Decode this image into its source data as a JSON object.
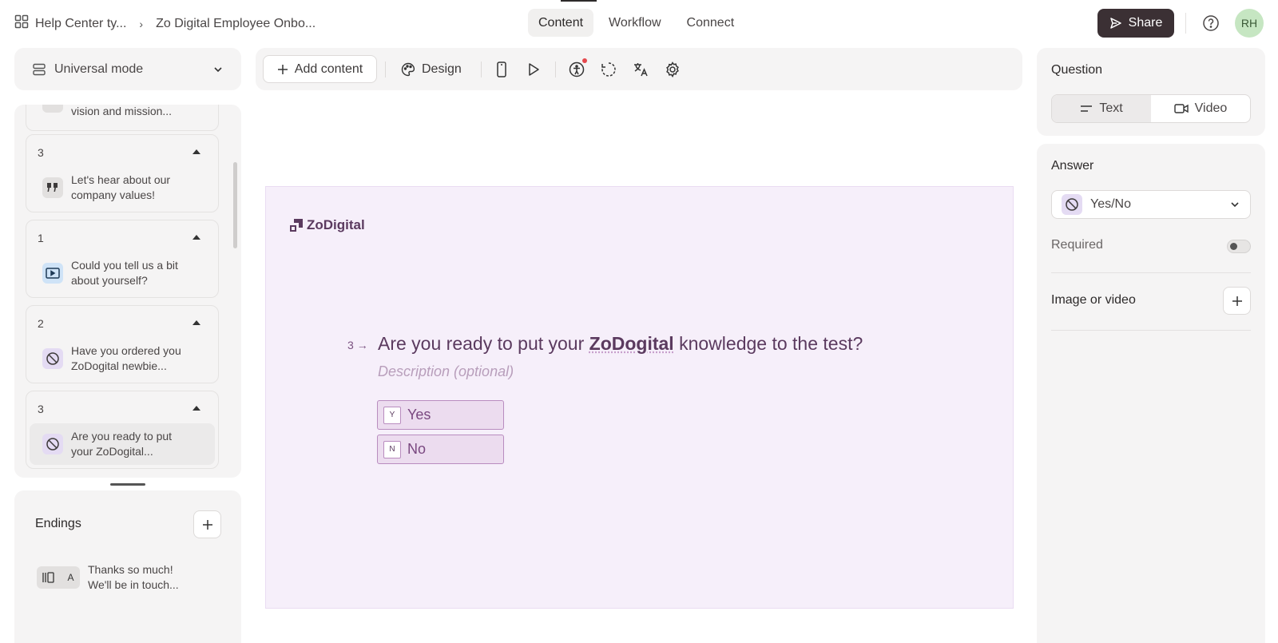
{
  "header": {
    "breadcrumb_workspace": "Help Center ty...",
    "breadcrumb_form": "Zo Digital Employee Onbo...",
    "tabs": [
      "Content",
      "Workflow",
      "Connect"
    ],
    "active_tab": "Content",
    "share_label": "Share",
    "avatar_initials": "RH"
  },
  "sidebar": {
    "mode_label": "Universal mode",
    "partial_item_text": "vision and mission...",
    "questions": [
      {
        "number": "3",
        "text_line1": "Let's hear about our",
        "text_line2": "company values!",
        "icon": "quote-icon"
      },
      {
        "number": "1",
        "text_line1": "Could you tell us a bit",
        "text_line2": "about yourself?",
        "icon": "video-icon"
      },
      {
        "number": "2",
        "text_line1": "Have you ordered you",
        "text_line2": "ZoDogital newbie...",
        "icon": "yes-no-icon"
      },
      {
        "number": "3",
        "text_line1": "Are you ready to put",
        "text_line2": "your ZoDogital...",
        "icon": "yes-no-icon"
      }
    ],
    "endings_title": "Endings",
    "ending": {
      "badge_letter": "A",
      "text_line1": "Thanks so much!",
      "text_line2": "We'll be in touch..."
    }
  },
  "toolbar": {
    "add_content_label": "Add content",
    "design_label": "Design"
  },
  "canvas": {
    "brand_name": "ZoDigital",
    "question_number": "3",
    "title_before": "Are you ready to put your ",
    "title_bold": "ZoDogital",
    "title_after": " knowledge to the test?",
    "description_placeholder": "Description (optional)",
    "options": [
      {
        "key": "Y",
        "label": "Yes"
      },
      {
        "key": "N",
        "label": "No"
      }
    ],
    "colors": {
      "background": "#f6effa",
      "accent": "#5b3a5f"
    }
  },
  "right_panel": {
    "question_title": "Question",
    "question_types": [
      "Text",
      "Video"
    ],
    "active_question_type": "Text",
    "answer_title": "Answer",
    "answer_type": "Yes/No",
    "required_label": "Required",
    "required_on": false,
    "image_video_label": "Image or video"
  }
}
